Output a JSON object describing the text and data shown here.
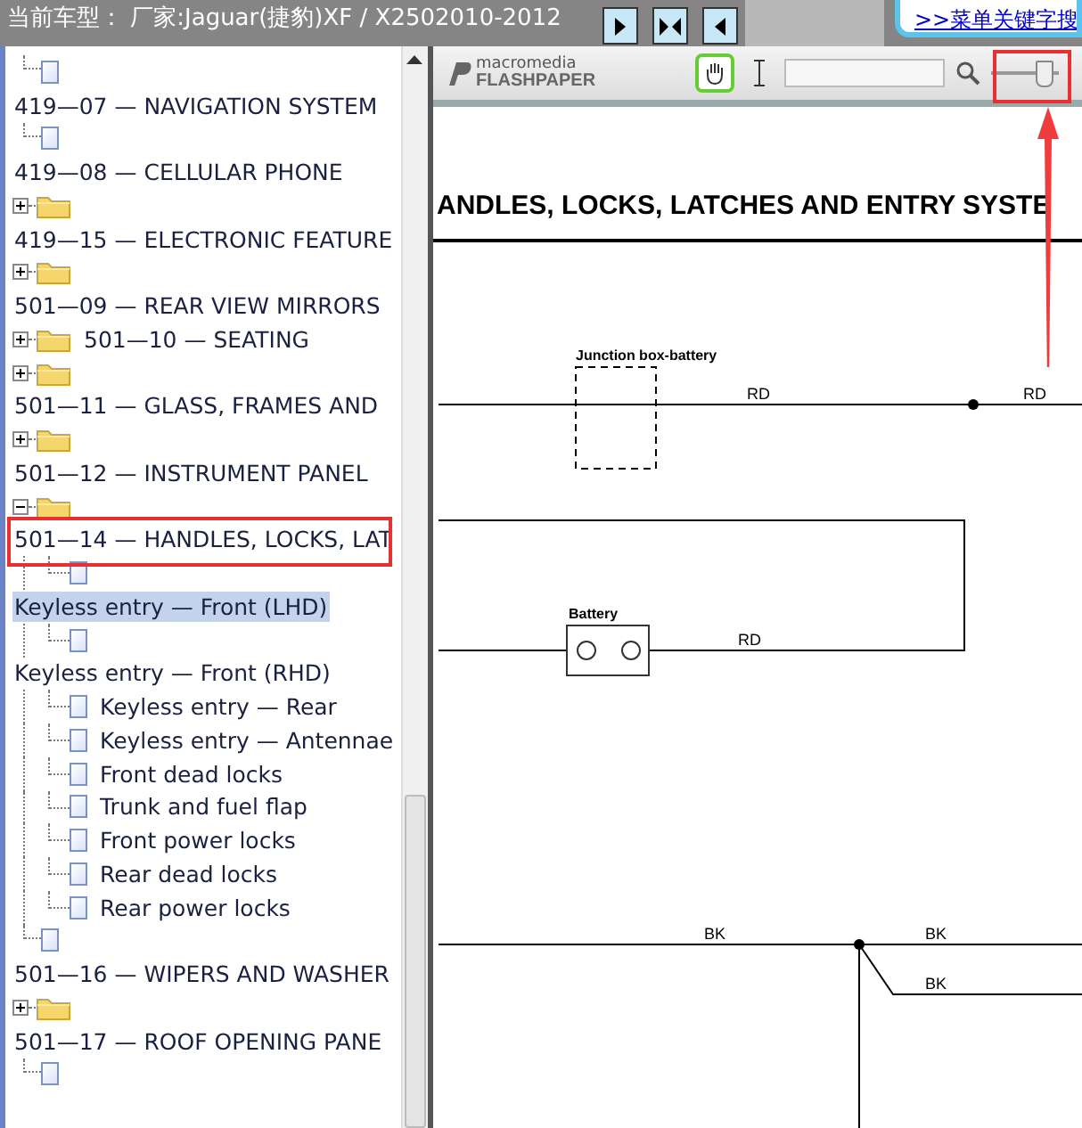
{
  "header": {
    "title": "当前车型： 厂家:Jaguar(捷豹)XF / X2502010-2012",
    "ad_link": ">>菜单关键字搜"
  },
  "tree": {
    "rows": [
      {
        "kind": "page"
      },
      {
        "kind": "label",
        "label": "419—07 — NAVIGATION SYSTEM",
        "selected": false
      },
      {
        "kind": "page"
      },
      {
        "kind": "label",
        "label": "419—08 — CELLULAR PHONE",
        "selected": false
      },
      {
        "kind": "folder",
        "expanded": false
      },
      {
        "kind": "label",
        "label": "419—15 — ELECTRONIC FEATURE",
        "selected": false
      },
      {
        "kind": "folder",
        "expanded": false
      },
      {
        "kind": "label",
        "label": "501—09 — REAR VIEW MIRRORS",
        "selected": false
      },
      {
        "kind": "folder-label",
        "expanded": false,
        "label": "501—10 — SEATING",
        "selected": false
      },
      {
        "kind": "folder",
        "expanded": false
      },
      {
        "kind": "label",
        "label": "501—11 — GLASS, FRAMES AND",
        "selected": false
      },
      {
        "kind": "folder",
        "expanded": false
      },
      {
        "kind": "label",
        "label": "501—12 — INSTRUMENT PANEL",
        "selected": false
      },
      {
        "kind": "folder",
        "expanded": true
      },
      {
        "kind": "label",
        "label": "501—14 — HANDLES, LOCKS, LAT",
        "selected": false
      },
      {
        "kind": "subpage"
      },
      {
        "kind": "label",
        "label": "Keyless entry — Front (LHD)",
        "selected": true
      },
      {
        "kind": "subpage"
      },
      {
        "kind": "label",
        "label": "Keyless entry — Front (RHD)",
        "selected": false
      },
      {
        "kind": "subpage-label",
        "label": "Keyless entry — Rear",
        "selected": false
      },
      {
        "kind": "subpage-label",
        "label": "Keyless entry — Antennae",
        "selected": false
      },
      {
        "kind": "subpage-label",
        "label": "Front dead locks",
        "selected": false
      },
      {
        "kind": "subpage-label",
        "label": "Trunk and fuel flap",
        "selected": false
      },
      {
        "kind": "subpage-label",
        "label": "Front power locks",
        "selected": false
      },
      {
        "kind": "subpage-label",
        "label": "Rear dead locks",
        "selected": false
      },
      {
        "kind": "subpage-label",
        "label": "Rear power locks",
        "selected": false
      },
      {
        "kind": "page"
      },
      {
        "kind": "label",
        "label": "501—16 — WIPERS AND WASHER",
        "selected": false
      },
      {
        "kind": "folder",
        "expanded": false
      },
      {
        "kind": "label",
        "label": "501—17 — ROOF OPENING PANE",
        "selected": false
      },
      {
        "kind": "page"
      }
    ]
  },
  "viewer": {
    "logo_top": "macromedia",
    "logo_bottom": "FLASHPAPER",
    "zoom": {
      "level": 0.75
    }
  },
  "diagram": {
    "title": "ANDLES, LOCKS, LATCHES AND ENTRY SYSTE",
    "junction_label": "Junction box-battery",
    "battery_label": "Battery",
    "wire_labels": [
      "RD",
      "RD",
      "RD",
      "BK",
      "BK",
      "BK"
    ]
  }
}
